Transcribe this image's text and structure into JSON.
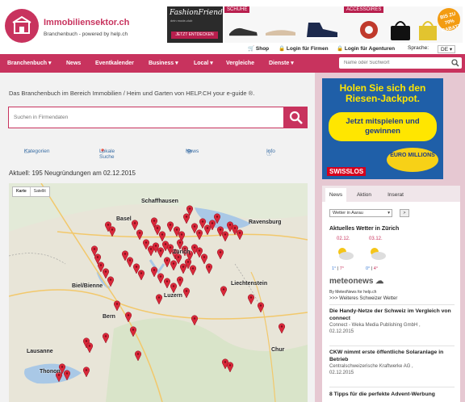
{
  "header": {
    "brand": "Immobiliensektor.ch",
    "tagline": "Branchenbuch - powered by help.ch",
    "ad": {
      "fashion_title": "FashionFriends",
      "fashion_sub": "dein mode-club",
      "fashion_cta": "JETZT ENTDECKEN",
      "shoes_tag": "SCHUHE",
      "acc_tag": "ACCESSOIRES",
      "sale_badge": "BIS ZU 70% RABATT"
    },
    "top_links": {
      "shop": "Shop",
      "login_firms": "Login für Firmen",
      "login_agents": "Login für Agenturen",
      "lang_label": "Sprache:",
      "lang_value": "DE"
    }
  },
  "nav": {
    "items": [
      "Branchenbuch",
      "News",
      "Eventkalender",
      "Business",
      "Local",
      "Vergleiche",
      "Dienste"
    ],
    "search_placeholder": "Name oder Suchwort"
  },
  "main": {
    "intro": "Das Branchenbuch im Bereich Immobilien / Heim und Garten von HELP.CH your e-guide ®.",
    "search_placeholder": "Suchen in Firmendaten",
    "tabs": [
      "Kategorien",
      "Lokale Suche",
      "News",
      "Info"
    ],
    "news_line": "Aktuell: 195 Neugründungen am 02.12.2015",
    "map": {
      "btn_map": "Karte",
      "btn_sat": "Satellit",
      "cities": [
        "Schaffhausen",
        "Ravensburg",
        "Basel",
        "Zürich",
        "Liechtenstein",
        "Bern",
        "Luzern",
        "Lausanne",
        "Chur",
        "Biel/Bienne",
        "Thonon"
      ]
    }
  },
  "sidebar": {
    "ad": {
      "headline": "Holen Sie sich den Riesen-Jackpot.",
      "pill": "Jetzt mitspielen und gewinnen",
      "euro": "EURO MILLIONS",
      "swisslos": "SWISSLOS"
    },
    "tabs": [
      "News",
      "Aktion",
      "Inserat"
    ],
    "weather_select": "Wetter in Aarau",
    "weather_go": ">",
    "weather_title": "Aktuelles Wetter in Zürich",
    "days": [
      {
        "date": "02.12.",
        "lo": "1°",
        "hi": "7°"
      },
      {
        "date": "03.12.",
        "lo": "0°",
        "hi": "4°"
      }
    ],
    "meteo_logo": "meteonews",
    "meteo_by": "By MeteoNews for help.ch",
    "meteo_more": ">>> Weiteres Schweizer Wetter",
    "articles": [
      {
        "title": "Die Handy-Netze der Schweiz im Vergleich von connect",
        "source": "Connect - Weka Media Publishing GmbH ,",
        "date": "02.12.2015"
      },
      {
        "title": "CKW nimmt erste öffentliche Solaranlage in Betrieb",
        "source": "Centralschweizerische Kraftwerke AG ,",
        "date": "02.12.2015"
      },
      {
        "title": "8 Tipps für die perfekte Advent-Werbung",
        "source": "",
        "date": ""
      }
    ]
  },
  "colors": {
    "brand": "#c8335e",
    "nav_bg": "#c8335e",
    "ad_blue": "#1f5fa8",
    "jackpot_yellow": "#ffe600"
  }
}
